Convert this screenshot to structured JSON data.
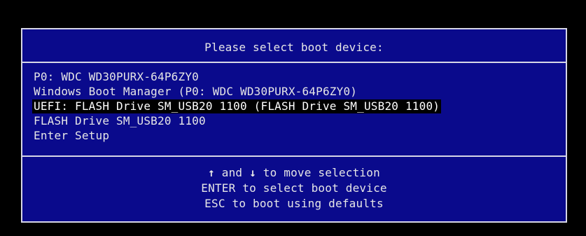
{
  "title": "Please select boot device:",
  "devices": [
    {
      "label": "P0: WDC WD30PURX-64P6ZY0"
    },
    {
      "label": "Windows Boot Manager (P0: WDC WD30PURX-64P6ZY0)"
    },
    {
      "label": "UEFI: FLASH Drive SM_USB20 1100 (FLASH Drive SM_USB20 1100)"
    },
    {
      "label": "FLASH Drive SM_USB20 1100"
    },
    {
      "label": "Enter Setup"
    }
  ],
  "selected_index": 2,
  "help": {
    "up_arrow": "↑",
    "and": "and",
    "down_arrow": "↓",
    "move_text": "to move selection",
    "enter_line": "ENTER to select boot device",
    "esc_line": "ESC to boot using defaults"
  },
  "colors": {
    "background": "#0a0a8c",
    "text": "#e6e6e6",
    "highlight_bg": "#000000",
    "highlight_text": "#ffffff"
  }
}
